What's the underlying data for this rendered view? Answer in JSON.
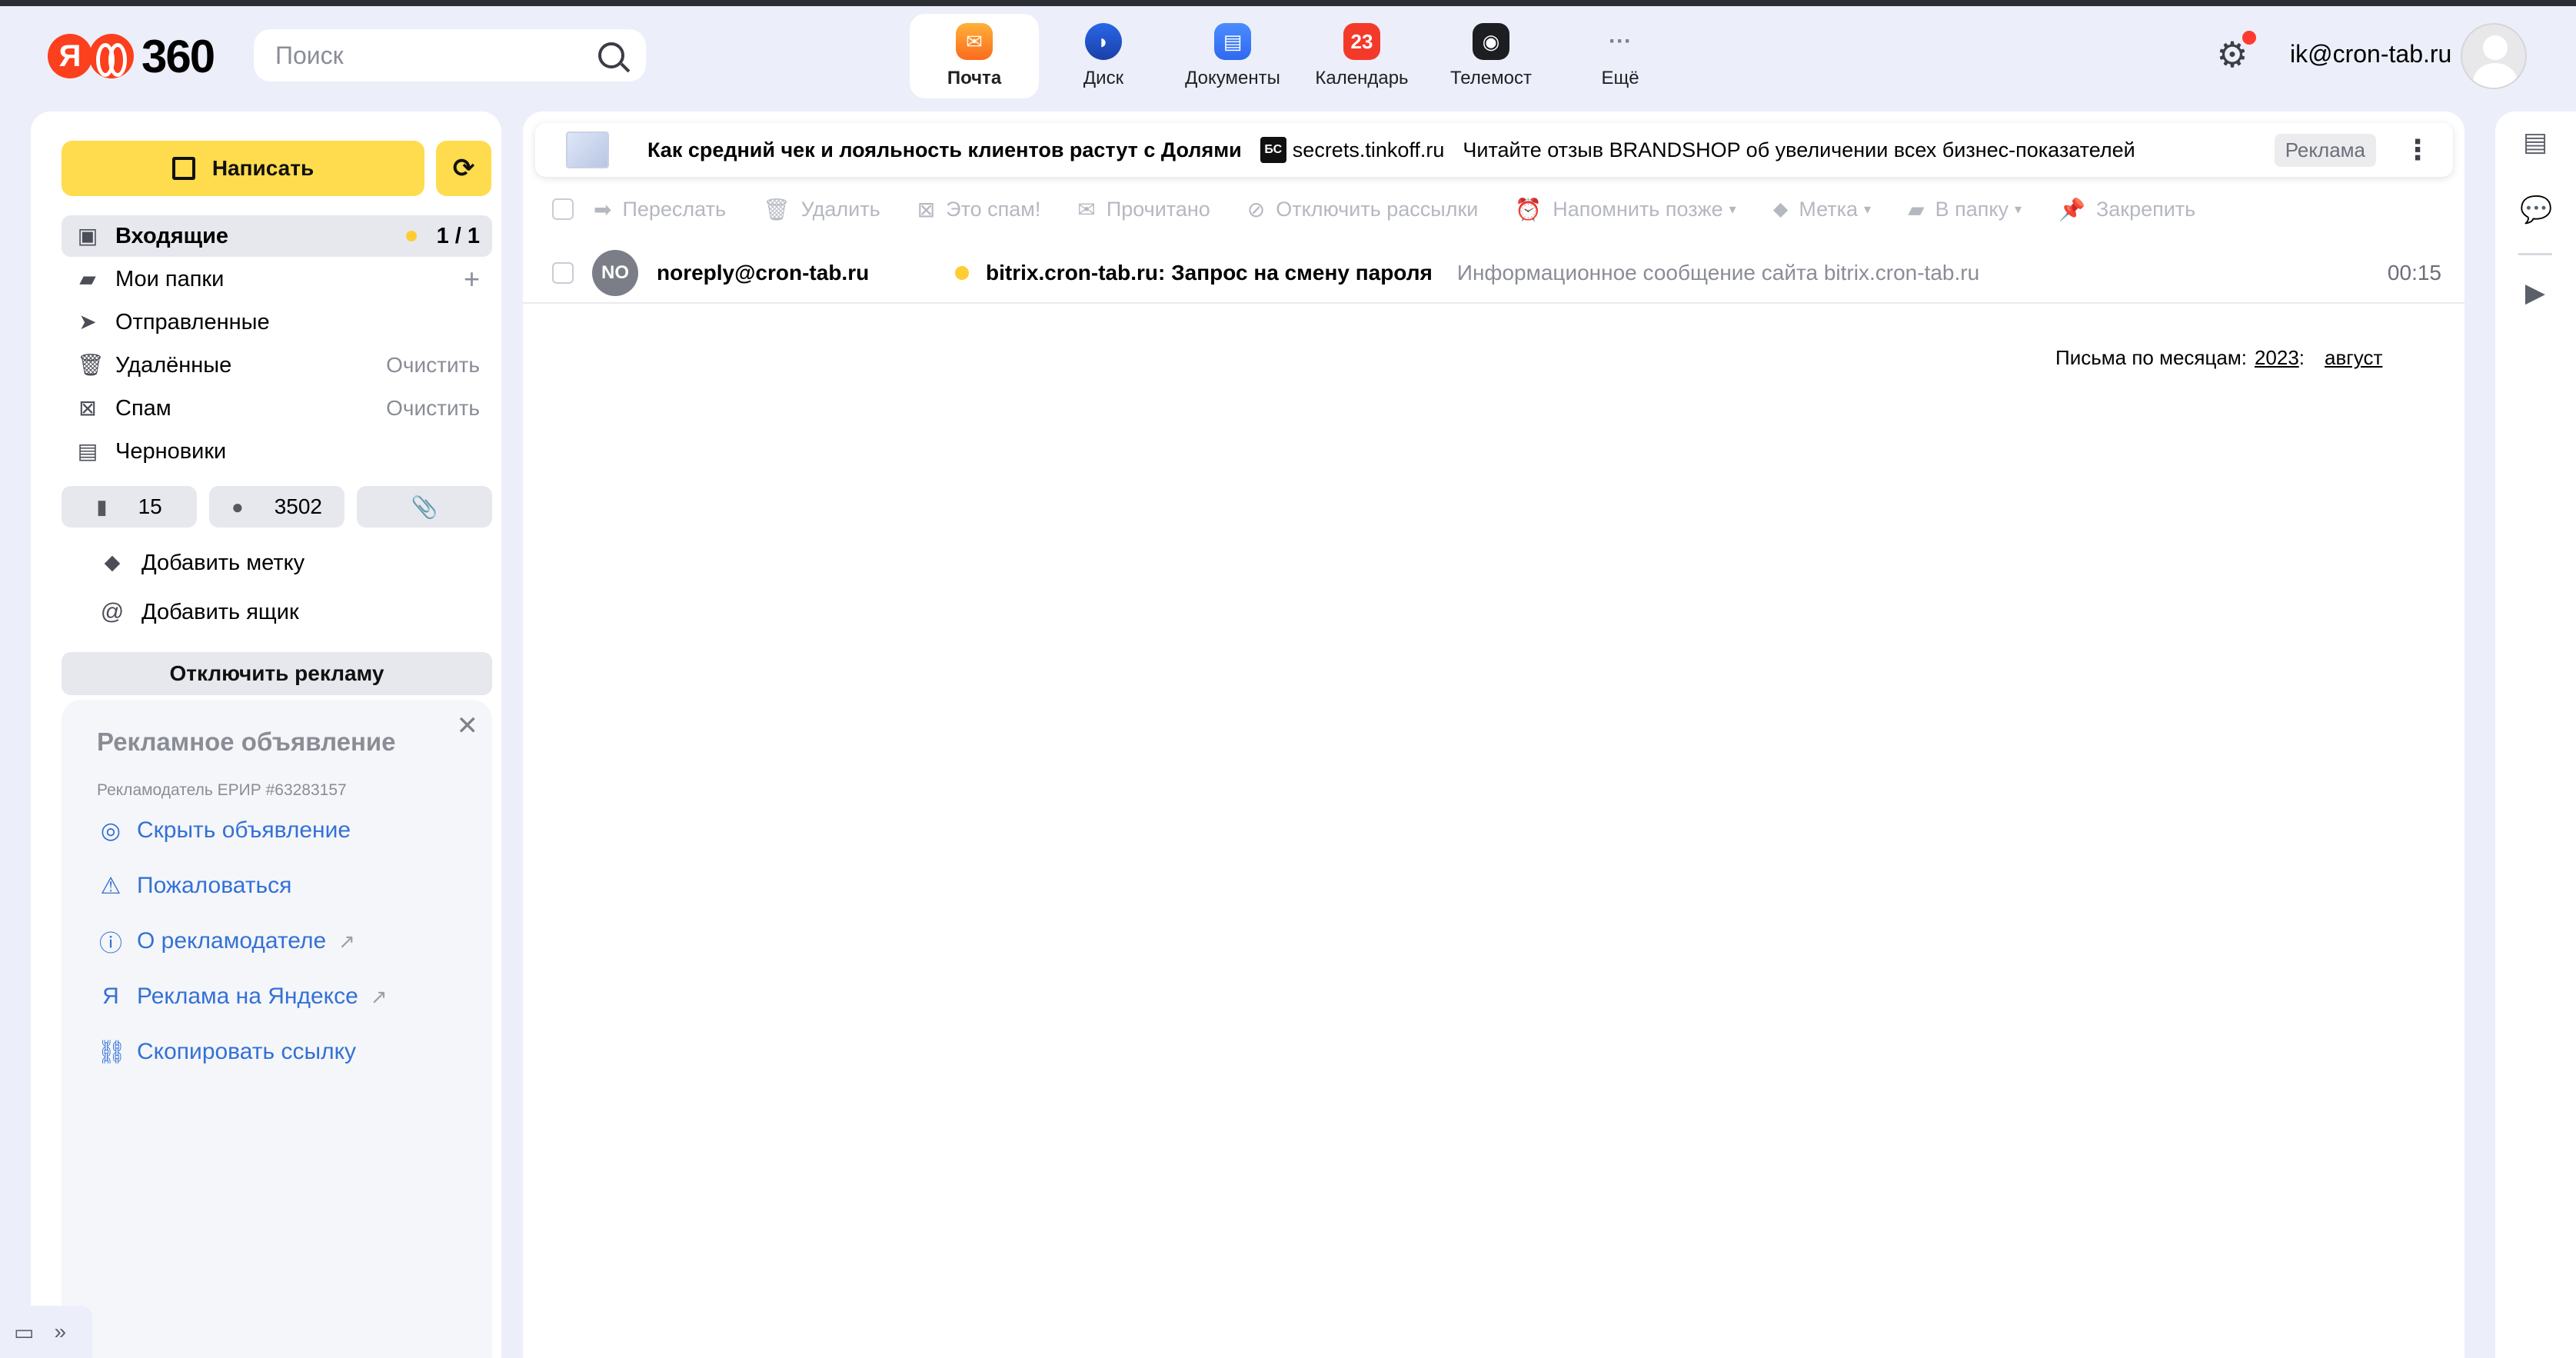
{
  "header": {
    "logo_text": "360",
    "logo_letter": "Я",
    "search_placeholder": "Поиск",
    "services": [
      {
        "label": "Почта",
        "icon": "mail-icon",
        "badge": ""
      },
      {
        "label": "Диск",
        "icon": "disk-icon",
        "badge": ""
      },
      {
        "label": "Документы",
        "icon": "documents-icon",
        "badge": ""
      },
      {
        "label": "Календарь",
        "icon": "calendar-icon",
        "badge": "23"
      },
      {
        "label": "Телемост",
        "icon": "telemost-icon",
        "badge": ""
      },
      {
        "label": "Ещё",
        "icon": "more-icon",
        "badge": "···"
      }
    ],
    "user_email": "ik@cron-tab.ru"
  },
  "sidebar": {
    "compose_label": "Написать",
    "folders": [
      {
        "label": "Входящие",
        "count": "1 / 1",
        "action": ""
      },
      {
        "label": "Мои папки",
        "count": "",
        "action": "+"
      },
      {
        "label": "Отправленные",
        "count": "",
        "action": ""
      },
      {
        "label": "Удалённые",
        "count": "",
        "action": "Очистить"
      },
      {
        "label": "Спам",
        "count": "",
        "action": "Очистить"
      },
      {
        "label": "Черновики",
        "count": "",
        "action": ""
      }
    ],
    "pills": [
      {
        "value": "15",
        "icon": "bookmark-icon"
      },
      {
        "value": "3502",
        "icon": "unread-dot-icon"
      },
      {
        "value": "",
        "icon": "attachment-icon"
      }
    ],
    "add_label": "Добавить метку",
    "add_mailbox": "Добавить ящик",
    "disable_ads": "Отключить рекламу",
    "ad": {
      "title": "Рекламное объявление",
      "advertiser": "Рекламодатель ЕРИР #63283157",
      "links": [
        {
          "label": "Скрыть объявление",
          "arrow": ""
        },
        {
          "label": "Пожаловаться",
          "arrow": ""
        },
        {
          "label": "О рекламодателе",
          "arrow": "↗"
        },
        {
          "label": "Реклама на Яндексе",
          "arrow": "↗"
        },
        {
          "label": "Скопировать ссылку",
          "arrow": ""
        }
      ]
    }
  },
  "adbar": {
    "headline": "Как средний чек и лояльность клиентов растут с Долями",
    "badge": "БС",
    "domain": "secrets.tinkoff.ru",
    "description": "Читайте отзыв BRANDSHOP об увеличении всех бизнес-показателей",
    "tag": "Реклама"
  },
  "toolbar": {
    "actions": [
      {
        "label": "Переслать",
        "icon": "forward-icon",
        "dropdown": ""
      },
      {
        "label": "Удалить",
        "icon": "trash-icon",
        "dropdown": ""
      },
      {
        "label": "Это спам!",
        "icon": "spam-icon",
        "dropdown": ""
      },
      {
        "label": "Прочитано",
        "icon": "read-icon",
        "dropdown": ""
      },
      {
        "label": "Отключить рассылки",
        "icon": "unsubscribe-icon",
        "dropdown": ""
      },
      {
        "label": "Напомнить позже",
        "icon": "remind-icon",
        "dropdown": "▾"
      },
      {
        "label": "Метка",
        "icon": "tag-icon",
        "dropdown": "▾"
      },
      {
        "label": "В папку",
        "icon": "folder-icon",
        "dropdown": "▾"
      },
      {
        "label": "Закрепить",
        "icon": "pin-icon",
        "dropdown": ""
      }
    ]
  },
  "messages": [
    {
      "avatar": "NO",
      "from": "noreply@cron-tab.ru",
      "subject": "bitrix.cron-tab.ru: Запрос на смену пароля",
      "preview": "Информационное сообщение сайта bitrix.cron-tab.ru",
      "time": "00:15"
    }
  ],
  "months": {
    "label": "Письма по месяцам:",
    "year": "2023",
    "sep": ":",
    "month": "август"
  },
  "colors": {
    "accent": "#ffdc4d",
    "link": "#3371d6",
    "background": "#eceff9"
  }
}
